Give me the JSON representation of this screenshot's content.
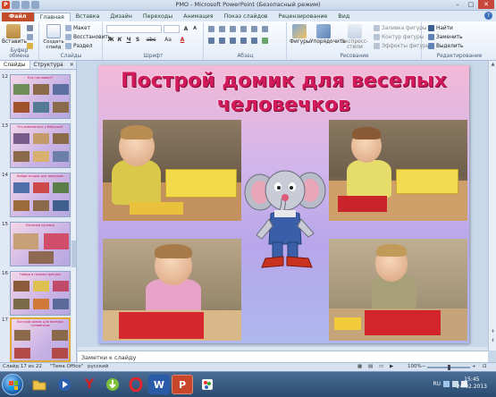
{
  "window": {
    "title": "РМО  -  Microsoft PowerPoint (Безопасный режим)",
    "controls": [
      "–",
      "□",
      "✕"
    ]
  },
  "qat": {
    "app_logo": "P"
  },
  "tabs": [
    {
      "label": "Файл"
    },
    {
      "label": "Главная"
    },
    {
      "label": "Вставка"
    },
    {
      "label": "Дизайн"
    },
    {
      "label": "Переходы"
    },
    {
      "label": "Анимация"
    },
    {
      "label": "Показ слайдов"
    },
    {
      "label": "Рецензирование"
    },
    {
      "label": "Вид"
    }
  ],
  "ribbon": {
    "clipboard": {
      "title": "Буфер обмена",
      "paste": "Вставить"
    },
    "slides": {
      "title": "Слайды",
      "new_slide": "Создать слайд",
      "layout": "Макет",
      "reset": "Восстановить",
      "section": "Раздел"
    },
    "font": {
      "title": "Шрифт",
      "bold": "Ж",
      "italic": "К",
      "underline": "Ч",
      "strike": "S",
      "abc": "abc",
      "case": "Aa",
      "font_color": "A"
    },
    "paragraph": {
      "title": "Абзац"
    },
    "drawing": {
      "title": "Рисование",
      "shapes": "Фигуры",
      "arrange": "Упорядочить",
      "quick_styles": "Экспресс-стили",
      "fill": "Заливка фигуры",
      "outline": "Контур фигуры",
      "effects": "Эффекты фигуры"
    },
    "editing": {
      "title": "Редактирование",
      "find": "Найти",
      "replace": "Заменить",
      "select": "Выделить"
    }
  },
  "left_panel": {
    "tabs": [
      "Слайды",
      "Структура"
    ],
    "close": "×",
    "thumbnails": [
      {
        "num": "12",
        "title": "Кто где живет?"
      },
      {
        "num": "13",
        "title": "Что изменилось у бабушки?"
      },
      {
        "num": "14",
        "title": "Найди ягодки для зверушек"
      },
      {
        "num": "15",
        "title": "Разложи пуговки"
      },
      {
        "num": "16",
        "title": "Найди и положи фигуры"
      },
      {
        "num": "17",
        "title": "Построй домик для веселых человечков"
      }
    ]
  },
  "slide": {
    "title": "Построй домик для веселых человечков"
  },
  "notes": {
    "placeholder": "Заметки к слайду"
  },
  "statusbar": {
    "slide_info": "Слайд 17 из 22",
    "theme": "\"Тема Office\"",
    "language": "русский",
    "zoom": "100%"
  },
  "taskbar": {
    "lang": "RU",
    "time": "15:45",
    "date": "24.02.2013"
  },
  "colors": {
    "title_pink": "#d21a5a",
    "file_tab": "#c24d2a",
    "ribbon_bg": "#e4ecf7"
  }
}
